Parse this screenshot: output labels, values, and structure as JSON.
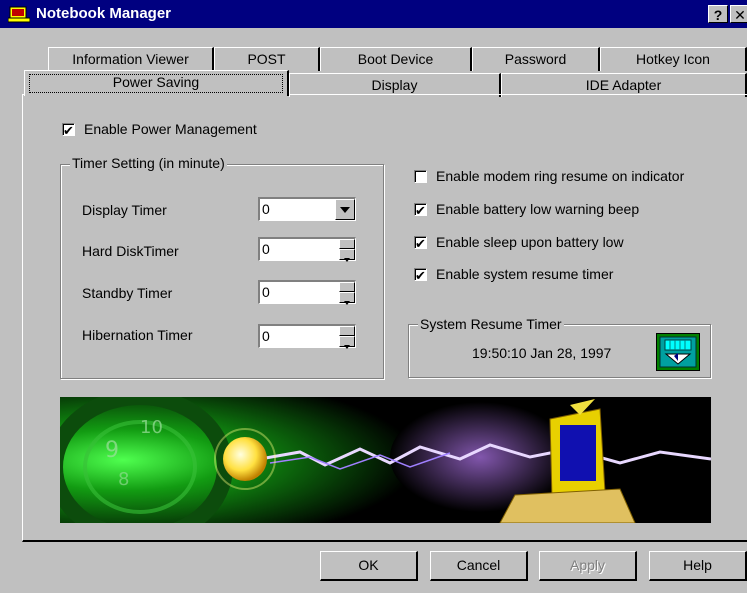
{
  "window": {
    "title": "Notebook Manager",
    "help_glyph": "?",
    "close_glyph": "✕"
  },
  "tabs": {
    "row1": [
      "Information Viewer",
      "POST",
      "Boot Device",
      "Password",
      "Hotkey Icon"
    ],
    "row2": [
      "Power Saving",
      "Display",
      "IDE Adapter"
    ],
    "active": "Power Saving"
  },
  "power": {
    "enable_pm": {
      "label": "Enable Power Management",
      "checked": true
    },
    "timer_group": {
      "title": "Timer Setting (in minute)",
      "display": {
        "label": "Display Timer",
        "value": "0"
      },
      "hdd": {
        "label": "Hard DiskTimer",
        "value": "0"
      },
      "standby": {
        "label": "Standby Timer",
        "value": "0"
      },
      "hibernation": {
        "label": "Hibernation Timer",
        "value": "0"
      }
    },
    "options": [
      {
        "label": "Enable modem ring resume on indicator",
        "checked": false
      },
      {
        "label": "Enable battery low warning beep",
        "checked": true
      },
      {
        "label": "Enable sleep upon battery low",
        "checked": true
      },
      {
        "label": "Enable system resume timer",
        "checked": true
      }
    ],
    "resume_timer": {
      "title": "System Resume Timer",
      "value": "19:50:10 Jan 28, 1997",
      "icon": "calendar-clock-icon"
    }
  },
  "banner": {
    "image": "power-saving-banner"
  },
  "buttons": {
    "ok": "OK",
    "cancel": "Cancel",
    "apply": "Apply",
    "help": "Help"
  },
  "colors": {
    "titlebar": "#000080",
    "face": "#c0c0c0",
    "banner_green": "#18a018"
  }
}
